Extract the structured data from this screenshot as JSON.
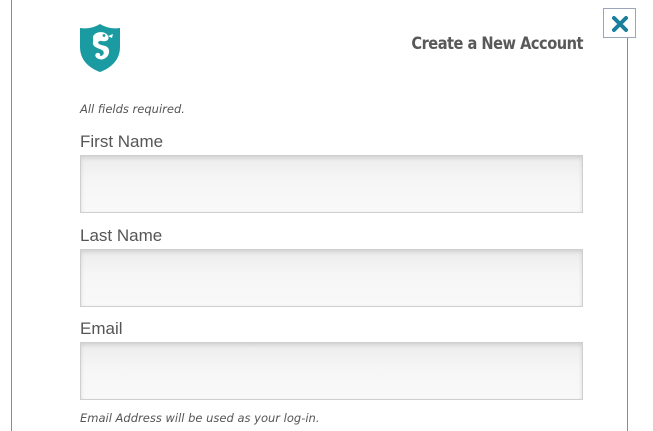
{
  "dialog": {
    "title": "Create a New Account",
    "logo_icon": "shield-seahorse-icon",
    "close_icon": "close-icon",
    "accent_color": "#1a9ba1",
    "required_note": "All fields required."
  },
  "form": {
    "fields": [
      {
        "label": "First Name",
        "value": "",
        "placeholder": ""
      },
      {
        "label": "Last Name",
        "value": "",
        "placeholder": ""
      },
      {
        "label": "Email",
        "value": "",
        "placeholder": ""
      }
    ],
    "email_hint": "Email Address will be used as your log-in."
  }
}
